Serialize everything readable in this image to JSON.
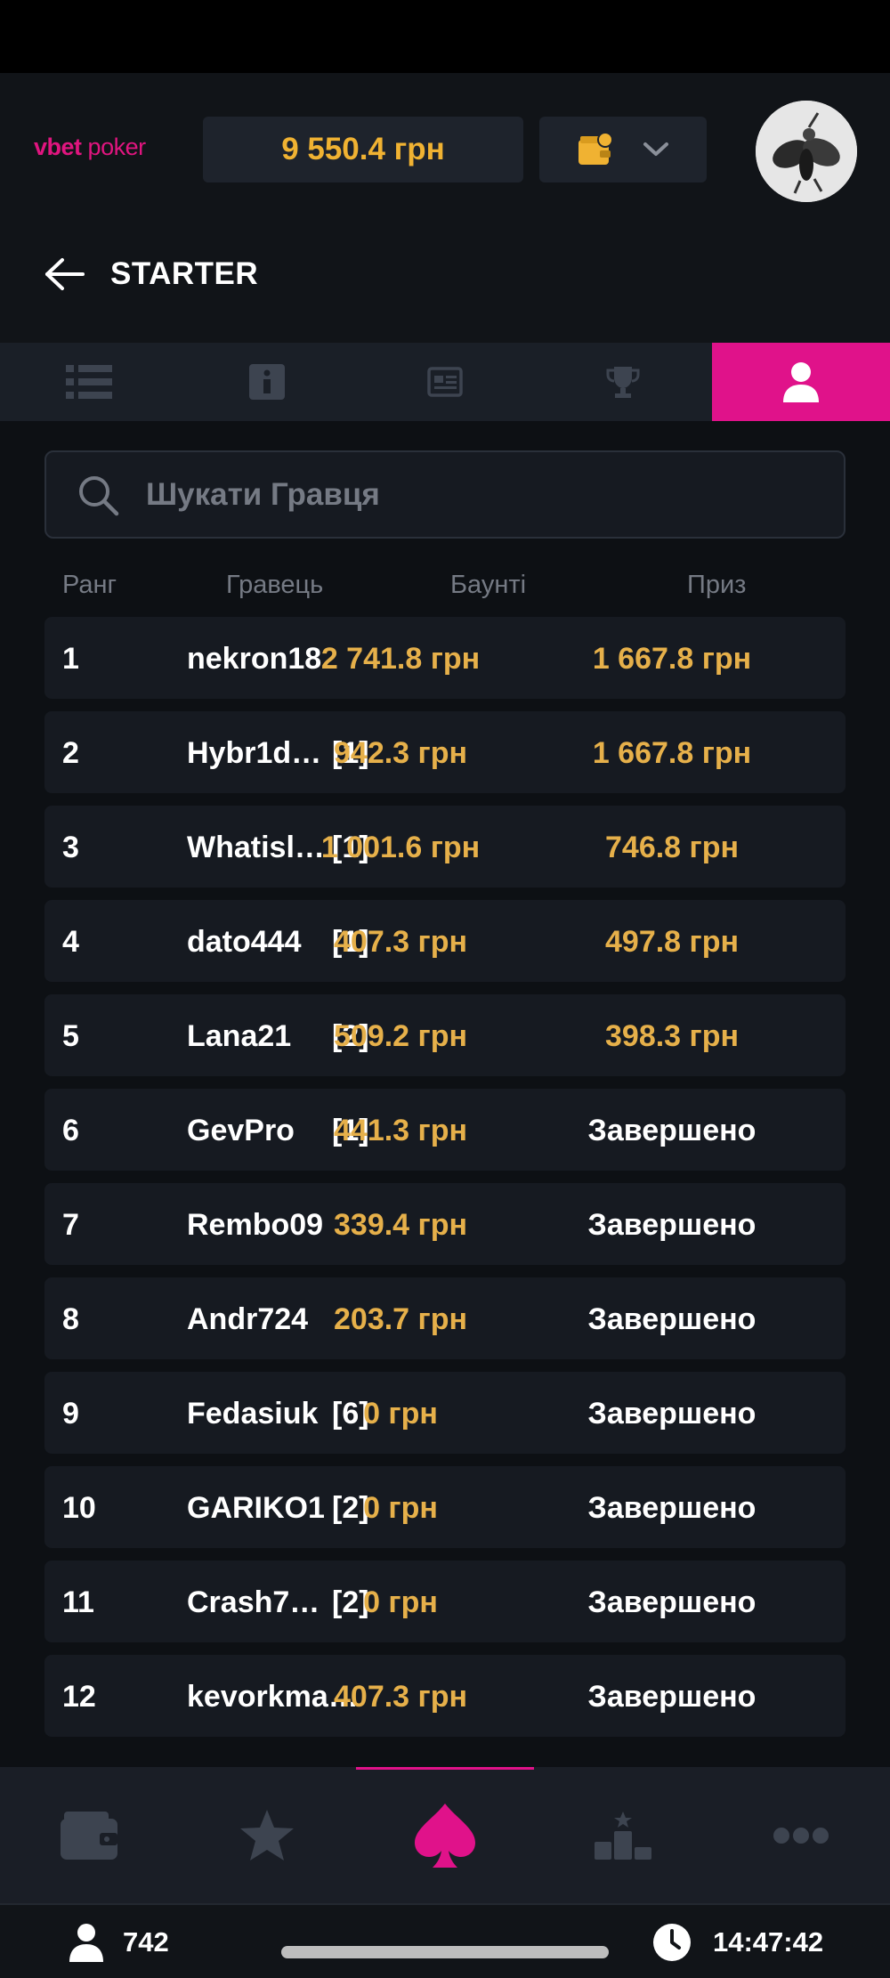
{
  "header": {
    "logo_brand": "vbet",
    "logo_product": "poker",
    "balance": "9 550.4 грн",
    "page_title": "STARTER"
  },
  "tabs": [
    {
      "icon": "list-icon",
      "active": false
    },
    {
      "icon": "info-icon",
      "active": false
    },
    {
      "icon": "tables-icon",
      "active": false
    },
    {
      "icon": "trophy-icon",
      "active": false
    },
    {
      "icon": "user-icon",
      "active": true
    }
  ],
  "search": {
    "placeholder": "Шукати Гравця"
  },
  "table": {
    "columns": [
      "Ранг",
      "Гравець",
      "Баунті",
      "Приз"
    ],
    "rows": [
      {
        "rank": "1",
        "name": "nekron18",
        "tag": "",
        "bounty": "2 741.8 грн",
        "prize": "1 667.8 грн",
        "finished": false
      },
      {
        "rank": "2",
        "name": "Hybr1d…",
        "tag": "[1]",
        "bounty": "942.3 грн",
        "prize": "1 667.8 грн",
        "finished": false
      },
      {
        "rank": "3",
        "name": "Whatisl…",
        "tag": "[1]",
        "bounty": "1 001.6 грн",
        "prize": "746.8 грн",
        "finished": false
      },
      {
        "rank": "4",
        "name": "dato444",
        "tag": "[1]",
        "bounty": "407.3 грн",
        "prize": "497.8 грн",
        "finished": false
      },
      {
        "rank": "5",
        "name": "Lana21",
        "tag": "[2]",
        "bounty": "509.2 грн",
        "prize": "398.3 грн",
        "finished": false
      },
      {
        "rank": "6",
        "name": "GevPro",
        "tag": "[1]",
        "bounty": "441.3 грн",
        "prize": "Завершено",
        "finished": true
      },
      {
        "rank": "7",
        "name": "Rembo09",
        "tag": "",
        "bounty": "339.4 грн",
        "prize": "Завершено",
        "finished": true
      },
      {
        "rank": "8",
        "name": "Andr724",
        "tag": "",
        "bounty": "203.7 грн",
        "prize": "Завершено",
        "finished": true
      },
      {
        "rank": "9",
        "name": "Fedasiuk",
        "tag": "[6]",
        "bounty": "0 грн",
        "prize": "Завершено",
        "finished": true
      },
      {
        "rank": "10",
        "name": "GARIKO1",
        "tag": "[2]",
        "bounty": "0 грн",
        "prize": "Завершено",
        "finished": true
      },
      {
        "rank": "11",
        "name": "Crash7…",
        "tag": "[2]",
        "bounty": "0 грн",
        "prize": "Завершено",
        "finished": true
      },
      {
        "rank": "12",
        "name": "kevorkma…",
        "tag": "",
        "bounty": "407.3 грн",
        "prize": "Завершено",
        "finished": true
      }
    ]
  },
  "bottom_nav": [
    {
      "icon": "wallet-icon",
      "active": false
    },
    {
      "icon": "star-icon",
      "active": false
    },
    {
      "icon": "spade-icon",
      "active": true
    },
    {
      "icon": "podium-icon",
      "active": false
    },
    {
      "icon": "more-icon",
      "active": false
    }
  ],
  "footer": {
    "online_count": "742",
    "time": "14:47:42"
  },
  "colors": {
    "accent": "#e0128a",
    "gold": "#e6b04a",
    "panel": "#161a21"
  }
}
